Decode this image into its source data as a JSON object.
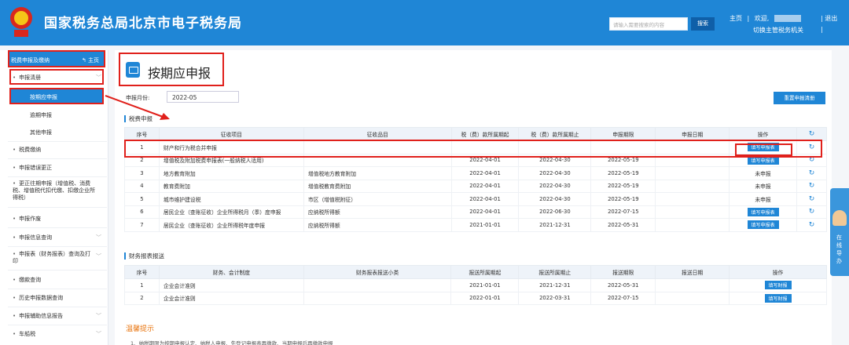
{
  "header": {
    "site_title": "国家税务总局北京市电子税务局",
    "search_placeholder": "请输入需要搜索的内容",
    "search_button": "搜索",
    "home_link": "主页",
    "welcome": "欢迎,",
    "exit_link": "退出",
    "switch_tax_office": "切换主管税务机关",
    "separator": "|"
  },
  "sidebar": {
    "header_label": "税费申报及缴纳",
    "home_label": "主页",
    "items": [
      {
        "label": "申报清册"
      },
      {
        "label": "按期应申报"
      },
      {
        "label": "逾期申报"
      },
      {
        "label": "其他申报"
      },
      {
        "label": "税费缴纳"
      },
      {
        "label": "申报错误更正"
      },
      {
        "label": "更正往期申报（增值税、消费税、增值税代扣代缴、扣缴企业所得税）"
      },
      {
        "label": "申报作废"
      },
      {
        "label": "申报信息查询"
      },
      {
        "label": "申报表（财务报表）查询及打印"
      },
      {
        "label": "缴款查询"
      },
      {
        "label": "历史申报数据查询"
      },
      {
        "label": "申报辅助信息报告"
      },
      {
        "label": "车船税"
      }
    ]
  },
  "main": {
    "page_title": "按期应申报",
    "period_label": "申报月份:",
    "period_value": "2022-05",
    "reset_button": "重置申报清册",
    "tax_section_title": "税费申报",
    "tax_table": {
      "headers": [
        "序号",
        "征收项目",
        "征收品目",
        "税（费）款所属期起",
        "税（费）款所属期止",
        "申报期限",
        "申报日期",
        "操作",
        ""
      ],
      "rows": [
        [
          "1",
          "财产和行为税合并申报",
          "",
          "",
          "",
          "",
          "",
          "填写申报表"
        ],
        [
          "2",
          "增值税及附加税费申报表(一般纳税人适用)",
          "",
          "2022-04-01",
          "2022-04-30",
          "2022-05-19",
          "",
          "填写申报表"
        ],
        [
          "3",
          "地方教育附加",
          "增值税地方教育附加",
          "2022-04-01",
          "2022-04-30",
          "2022-05-19",
          "",
          "未申报"
        ],
        [
          "4",
          "教育费附加",
          "增值税教育费附加",
          "2022-04-01",
          "2022-04-30",
          "2022-05-19",
          "",
          "未申报"
        ],
        [
          "5",
          "城市维护建设税",
          "市区（增值税附征）",
          "2022-04-01",
          "2022-04-30",
          "2022-05-19",
          "",
          "未申报"
        ],
        [
          "6",
          "居民企业（查账征收）企业所得税月（季）度申报",
          "应纳税所得额",
          "2022-04-01",
          "2022-06-30",
          "2022-07-15",
          "",
          "填写申报表"
        ],
        [
          "7",
          "居民企业（查账征收）企业所得税年度申报",
          "应纳税所得额",
          "2021-01-01",
          "2021-12-31",
          "2022-05-31",
          "",
          "填写申报表"
        ]
      ]
    },
    "fin_section_title": "财务报表报送",
    "fin_table": {
      "headers": [
        "序号",
        "财务、会计制度",
        "财务报表报送小类",
        "报送所属期起",
        "报送所属期止",
        "报送期限",
        "报送日期",
        "操作"
      ],
      "rows": [
        [
          "1",
          "企业会计准则",
          "",
          "2021-01-01",
          "2021-12-31",
          "2022-05-31",
          "",
          "填写财报"
        ],
        [
          "2",
          "企业会计准则",
          "",
          "2022-01-01",
          "2022-03-31",
          "2022-07-15",
          "",
          "填写财报"
        ]
      ]
    },
    "tips_title": "温馨提示",
    "tips_text": "1、纳税期限为按期申报认定、纳税人申报、先登记申报表再缴款、当期申报后再缴款申报"
  },
  "float_nav": {
    "label": "在线导办"
  },
  "colors": {
    "brand": "#1f86d6",
    "annotation": "#e0201b",
    "tips": "#e8730c"
  }
}
